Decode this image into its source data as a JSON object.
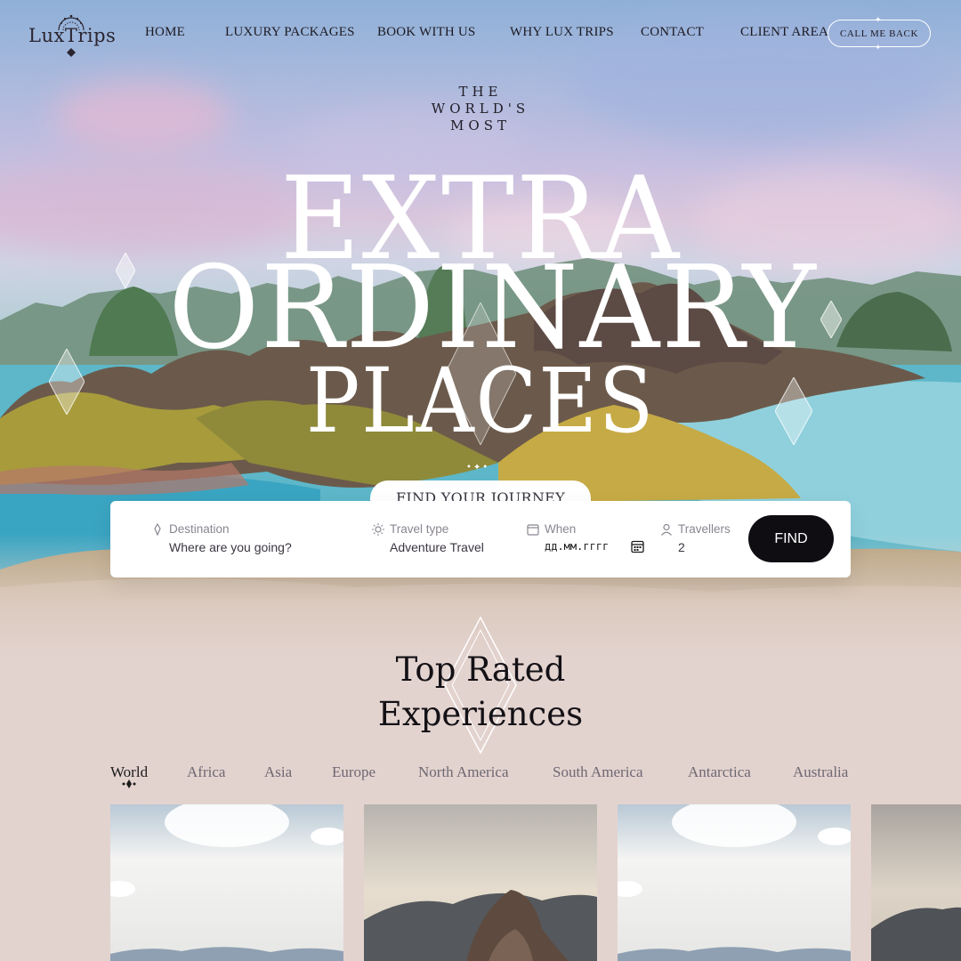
{
  "brand": {
    "name": "LuxTrips"
  },
  "nav": {
    "items": [
      "HOME",
      "LUXURY PACKAGES",
      "BOOK WITH US",
      "WHY LUX TRIPS",
      "CONTACT",
      "CLIENT AREA"
    ],
    "cta": "CALL ME BACK"
  },
  "hero": {
    "pretitle": [
      "THE",
      "WORLD'S",
      "MOST"
    ],
    "line1": "EXTRA",
    "line2": "ORDINARY",
    "line3": "PLACES"
  },
  "search": {
    "tab_label": "FIND YOUR JOURNEY",
    "destination": {
      "label": "Destination",
      "placeholder": "Where are you going?",
      "icon": "pin-icon"
    },
    "travel_type": {
      "label": "Travel type",
      "value": "Adventure Travel",
      "icon": "sun-icon"
    },
    "when": {
      "label": "When",
      "value": "дд.мм.гггг",
      "icon": "calendar-icon"
    },
    "travellers": {
      "label": "Travellers",
      "value": "2",
      "icon": "user-icon"
    },
    "button": "FIND"
  },
  "top_rated": {
    "title_line1": "Top Rated",
    "title_line2": "Experiences",
    "tabs": [
      "World",
      "Africa",
      "Asia",
      "Europe",
      "North America",
      "South America",
      "Antarctica",
      "Australia"
    ],
    "active_tab": "World"
  },
  "colors": {
    "accent": "#0f0d12",
    "background": "#e3d3cf",
    "white": "#ffffff"
  }
}
